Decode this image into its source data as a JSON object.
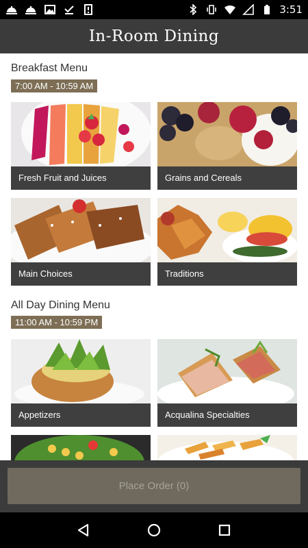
{
  "status_bar": {
    "time": "3:51",
    "left_icons": [
      "service-bell-icon",
      "service-bell-icon",
      "image-icon",
      "download-check-icon",
      "notification-icon"
    ],
    "right_icons": [
      "bluetooth-icon",
      "vibrate-icon",
      "wifi-icon",
      "signal-icon",
      "battery-icon"
    ]
  },
  "app_bar": {
    "title": "In-Room Dining"
  },
  "sections": [
    {
      "title": "Breakfast Menu",
      "hours": "7:00 AM - 10:59 AM",
      "tiles": [
        {
          "label": "Fresh Fruit and Juices"
        },
        {
          "label": "Grains and Cereals"
        },
        {
          "label": "Main Choices"
        },
        {
          "label": "Traditions"
        }
      ]
    },
    {
      "title": "All Day Dining Menu",
      "hours": "11:00 AM - 10:59 PM",
      "tiles": [
        {
          "label": "Appetizers"
        },
        {
          "label": "Acqualina Specialties"
        },
        {
          "label": ""
        },
        {
          "label": ""
        }
      ]
    }
  ],
  "order_button": {
    "label": "Place Order (0)"
  },
  "nav_bar": {
    "icons": [
      "back-icon",
      "home-icon",
      "recents-icon"
    ]
  },
  "colors": {
    "app_bar": "#3b3b3b",
    "badge": "#7d6e55",
    "caption": "#3f3f3f",
    "order_button": "#6f6a5d"
  }
}
